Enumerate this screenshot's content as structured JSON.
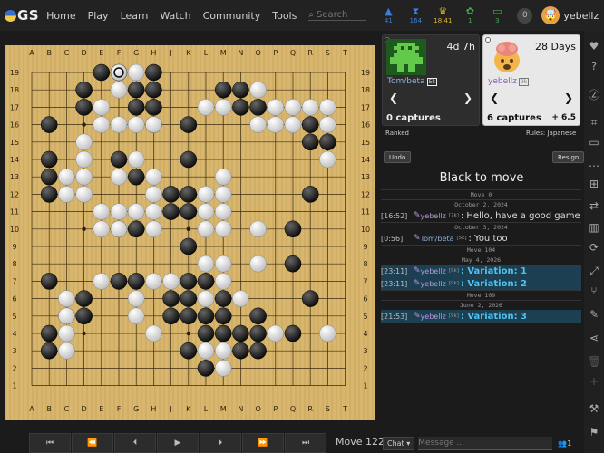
{
  "nav": {
    "logo_text": "GS",
    "links": [
      "Home",
      "Play",
      "Learn",
      "Watch",
      "Community",
      "Tools"
    ],
    "search_placeholder": "Search",
    "status": [
      {
        "icon": "triangle-icon",
        "glyph": "▲",
        "color": "#3f7ed8",
        "value": "41"
      },
      {
        "icon": "hourglass-icon",
        "glyph": "⧗",
        "color": "#3f7ed8",
        "value": "164"
      },
      {
        "icon": "trophy-icon",
        "glyph": "♛",
        "color": "#e0b52a",
        "value": "18:41"
      },
      {
        "icon": "turtle-icon",
        "glyph": "✿",
        "color": "#3fae52",
        "value": "1"
      },
      {
        "icon": "monitor-icon",
        "glyph": "▭",
        "color": "#3fae52",
        "value": "3"
      }
    ],
    "notification_count": "0",
    "username": "yebellz"
  },
  "board": {
    "columns": [
      "A",
      "B",
      "C",
      "D",
      "E",
      "F",
      "G",
      "H",
      "J",
      "K",
      "L",
      "M",
      "N",
      "O",
      "P",
      "Q",
      "R",
      "S",
      "T"
    ],
    "rows": [
      "19",
      "18",
      "17",
      "16",
      "15",
      "14",
      "13",
      "12",
      "11",
      "10",
      "9",
      "8",
      "7",
      "6",
      "5",
      "4",
      "3",
      "2",
      "1"
    ],
    "last_move": "F19",
    "stones": {
      "black": [
        "E19",
        "H19",
        "D18",
        "G18",
        "H18",
        "D17",
        "G17",
        "H17",
        "N17",
        "O17",
        "M18",
        "N18",
        "B16",
        "H16",
        "K16",
        "R16",
        "R15",
        "S15",
        "B14",
        "B13",
        "B12",
        "F14",
        "K14",
        "G13",
        "J12",
        "K12",
        "J11",
        "K11",
        "R12",
        "G10",
        "F10",
        "Q10",
        "K9",
        "Q8",
        "B7",
        "F7",
        "G7",
        "K7",
        "L7",
        "D6",
        "J6",
        "K6",
        "M6",
        "R6",
        "C5",
        "D5",
        "J5",
        "K5",
        "L5",
        "M5",
        "O5",
        "B4",
        "B3",
        "L4",
        "M4",
        "N4",
        "O4",
        "Q4",
        "K3",
        "N3",
        "O3",
        "L2"
      ],
      "white": [
        "F18",
        "G19",
        "E17",
        "E16",
        "F16",
        "G16",
        "H16",
        "O16",
        "O18",
        "M17",
        "L17",
        "P17",
        "Q17",
        "R17",
        "S17",
        "S16",
        "Q16",
        "P16",
        "S14",
        "D15",
        "D14",
        "D13",
        "C13",
        "C12",
        "D12",
        "G14",
        "F13",
        "H13",
        "H12",
        "E11",
        "F11",
        "G11",
        "H11",
        "E10",
        "F10",
        "H10",
        "M13",
        "M12",
        "L12",
        "L11",
        "M11",
        "M10",
        "L10",
        "O10",
        "M8",
        "O8",
        "L8",
        "E7",
        "H7",
        "J7",
        "M7",
        "C6",
        "G6",
        "C5",
        "G5",
        "L6",
        "N6",
        "C4",
        "C3",
        "H4",
        "M3",
        "P4",
        "S4",
        "L3",
        "M2"
      ]
    }
  },
  "controls": {
    "buttons": [
      {
        "name": "first-move-button",
        "glyph": "⏮"
      },
      {
        "name": "back-10-button",
        "glyph": "⏪"
      },
      {
        "name": "prev-move-button",
        "glyph": "⏴"
      },
      {
        "name": "play-button",
        "glyph": "▶"
      },
      {
        "name": "next-move-button",
        "glyph": "⏵"
      },
      {
        "name": "forward-10-button",
        "glyph": "⏩"
      },
      {
        "name": "last-move-button",
        "glyph": "⏭"
      }
    ],
    "move_label": "Move 122"
  },
  "players": {
    "black": {
      "clock": "4d 7h",
      "name": "Tom/beta",
      "rank": "5k",
      "captures": "0 captures"
    },
    "white": {
      "clock": "28 Days",
      "name": "yebellz",
      "rank": "9k",
      "captures": "6 captures",
      "komi": "+ 6.5"
    }
  },
  "game": {
    "ranked": "Ranked",
    "rules": "Rules: Japanese",
    "undo": "Undo",
    "resign": "Resign",
    "to_move": "Black to move"
  },
  "chat": {
    "entries": [
      {
        "kind": "sep",
        "text": "Move 0"
      },
      {
        "kind": "sep",
        "text": "October 2, 2024"
      },
      {
        "kind": "msg",
        "ts": "[16:52]",
        "who": "yebellz",
        "rank": "[7k]",
        "cls": "y",
        "text": ": Hello, have a good game"
      },
      {
        "kind": "sep",
        "text": "October 3, 2024"
      },
      {
        "kind": "msg",
        "ts": "[0:56]",
        "who": "Tom/beta",
        "rank": "[5k]",
        "cls": "t",
        "text": ": You too"
      },
      {
        "kind": "sep",
        "text": "Move 104"
      },
      {
        "kind": "sep",
        "text": "May 4, 2026"
      },
      {
        "kind": "var",
        "ts": "[23:11]",
        "who": "yebellz",
        "rank": "[9k]",
        "cls": "y",
        "text": ": Variation: 1"
      },
      {
        "kind": "var",
        "ts": "[23:11]",
        "who": "yebellz",
        "rank": "[9k]",
        "cls": "y",
        "text": ": Variation: 2"
      },
      {
        "kind": "sep",
        "text": "Move 109"
      },
      {
        "kind": "sep",
        "text": "June 2, 2026"
      },
      {
        "kind": "var",
        "ts": "[21:53]",
        "who": "yebellz",
        "rank": "[9k]",
        "cls": "y",
        "text": ": Variation: 3"
      }
    ],
    "channel": "Chat",
    "placeholder": "Message ...",
    "users": "1"
  },
  "dock": [
    {
      "name": "heart-icon",
      "glyph": "♥",
      "dim": false
    },
    {
      "name": "help-icon",
      "glyph": "?",
      "dim": false
    },
    {
      "name": "zen-icon",
      "glyph": "Ⓩ",
      "dim": false
    },
    {
      "name": "coordinates-icon",
      "glyph": "⌗",
      "dim": false
    },
    {
      "name": "monitor-icon",
      "glyph": "▭",
      "dim": false
    },
    {
      "name": "share-icon",
      "glyph": "⋯",
      "dim": false
    },
    {
      "name": "tree-icon",
      "glyph": "⊞",
      "dim": false
    },
    {
      "name": "exchange-icon",
      "glyph": "⇄",
      "dim": false
    },
    {
      "name": "columns-icon",
      "glyph": "▥",
      "dim": false
    },
    {
      "name": "refresh-icon",
      "glyph": "⟳",
      "dim": false
    },
    {
      "name": "analyze-icon",
      "glyph": "⤢",
      "dim": false
    },
    {
      "name": "branch-icon",
      "glyph": "⑂",
      "dim": false
    },
    {
      "name": "pencil-icon",
      "glyph": "✎",
      "dim": false
    },
    {
      "name": "share-alt-icon",
      "glyph": "⋖",
      "dim": false
    },
    {
      "name": "trash-icon",
      "glyph": "🗑",
      "dim": true
    },
    {
      "name": "add-icon",
      "glyph": "+",
      "dim": true
    },
    {
      "name": "gavel-icon",
      "glyph": "⚒",
      "dim": false
    },
    {
      "name": "flag-icon",
      "glyph": "⚑",
      "dim": false
    }
  ]
}
